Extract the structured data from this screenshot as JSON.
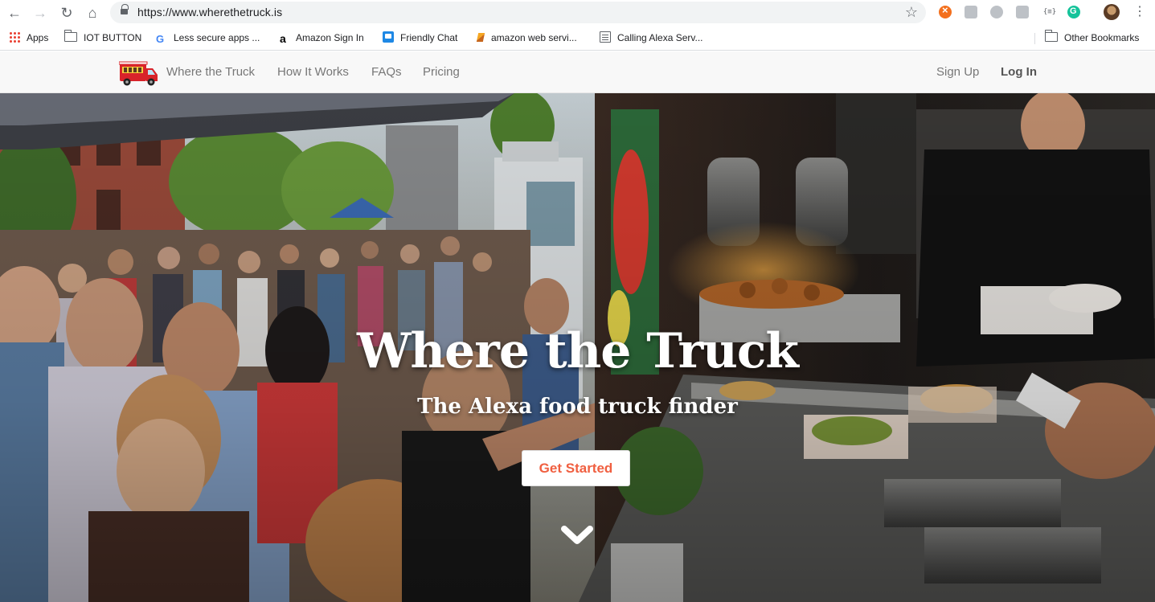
{
  "browser": {
    "url": "https://www.wherethetruck.is",
    "extension_json_label": "{≡}"
  },
  "bookmarks": {
    "items": [
      {
        "label": "Apps",
        "icon": "apps-grid-icon"
      },
      {
        "label": "IOT BUTTON",
        "icon": "folder-icon"
      },
      {
        "label": "Less secure apps ...",
        "icon": "google-icon"
      },
      {
        "label": "Amazon Sign In",
        "icon": "amazon-icon"
      },
      {
        "label": "Friendly Chat",
        "icon": "chat-icon"
      },
      {
        "label": "amazon web servi...",
        "icon": "aws-icon"
      },
      {
        "label": "Calling Alexa Serv...",
        "icon": "document-icon"
      }
    ],
    "other": "Other Bookmarks"
  },
  "site_nav": {
    "brand": "Where the Truck",
    "links": [
      "How It Works",
      "FAQs",
      "Pricing"
    ],
    "signup": "Sign Up",
    "login": "Log In"
  },
  "hero": {
    "title": "Where the Truck",
    "subtitle": "The Alexa food truck finder",
    "cta": "Get Started"
  },
  "colors": {
    "accent": "#f05f40",
    "nav_bg": "#f8f8f8",
    "nav_text": "#777777"
  }
}
